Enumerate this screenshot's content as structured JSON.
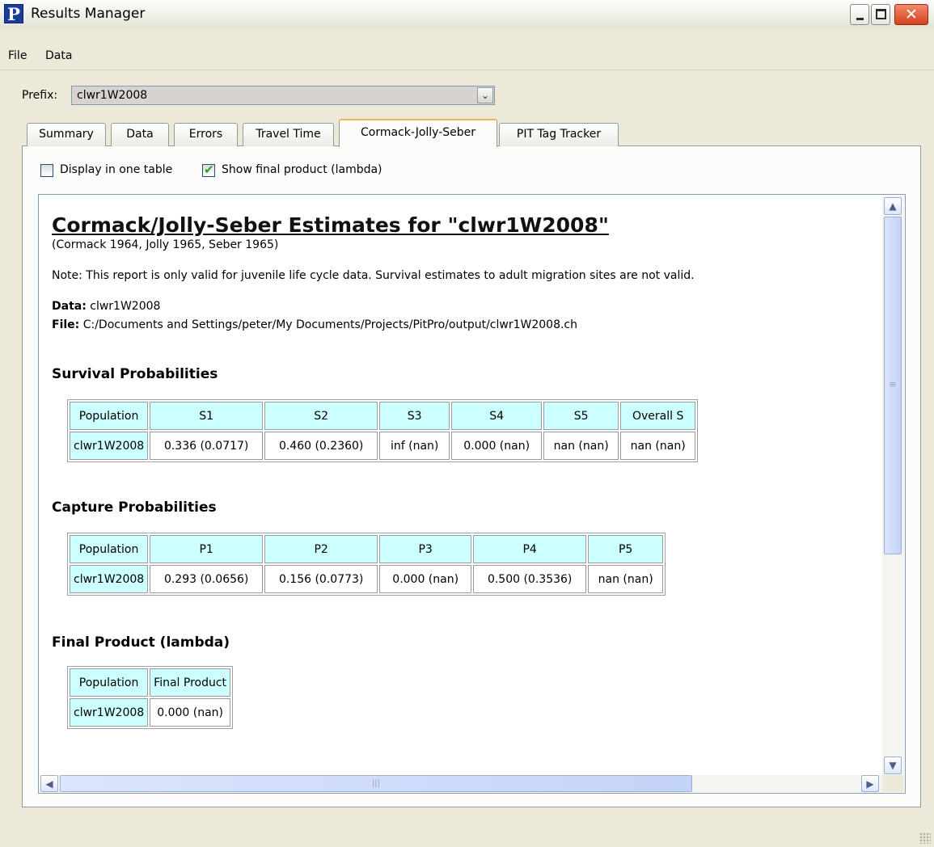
{
  "window": {
    "app_icon_letter": "P",
    "title": "Results Manager",
    "close_glyph": "✕"
  },
  "menu": {
    "items": [
      "File",
      "Data"
    ]
  },
  "prefix": {
    "label": "Prefix:",
    "value": "clwr1W2008",
    "dropdown_glyph": "⌄"
  },
  "tabs": [
    {
      "label": "Summary",
      "active": false
    },
    {
      "label": "Data",
      "active": false
    },
    {
      "label": "Errors",
      "active": false
    },
    {
      "label": "Travel Time",
      "active": false
    },
    {
      "label": "Cormack-Jolly-Seber",
      "active": true
    },
    {
      "label": "PIT Tag Tracker",
      "active": false
    }
  ],
  "options": {
    "display_one_table": {
      "label": "Display in one table",
      "checked": false
    },
    "show_final_product": {
      "label": "Show final product (lambda)",
      "checked": true
    }
  },
  "report": {
    "title": "Cormack/Jolly-Seber Estimates for \"clwr1W2008\"",
    "citation": "(Cormack 1964, Jolly 1965, Seber 1965)",
    "note": "Note: This report is only valid for juvenile life cycle data. Survival estimates to adult migration sites are not valid.",
    "data_label": "Data:",
    "data_value": "clwr1W2008",
    "file_label": "File:",
    "file_value": "C:/Documents and Settings/peter/My Documents/Projects/PitPro/output/clwr1W2008.ch",
    "survival": {
      "heading": "Survival Probabilities",
      "headers": [
        "Population",
        "S1",
        "S2",
        "S3",
        "S4",
        "S5",
        "Overall S"
      ],
      "rows": [
        [
          "clwr1W2008",
          "0.336 (0.0717)",
          "0.460 (0.2360)",
          "inf (nan)",
          "0.000 (nan)",
          "nan (nan)",
          "nan (nan)"
        ]
      ]
    },
    "capture": {
      "heading": "Capture Probabilities",
      "headers": [
        "Population",
        "P1",
        "P2",
        "P3",
        "P4",
        "P5"
      ],
      "rows": [
        [
          "clwr1W2008",
          "0.293 (0.0656)",
          "0.156 (0.0773)",
          "0.000 (nan)",
          "0.500 (0.3536)",
          "nan (nan)"
        ]
      ]
    },
    "final_product": {
      "heading": "Final Product (lambda)",
      "headers": [
        "Population",
        "Final Product"
      ],
      "rows": [
        [
          "clwr1W2008",
          "0.000 (nan)"
        ]
      ]
    }
  },
  "scrollbars": {
    "up": "▲",
    "down": "▼",
    "left": "◀",
    "right": "▶",
    "grip": "≡",
    "hgrip": "|||"
  }
}
